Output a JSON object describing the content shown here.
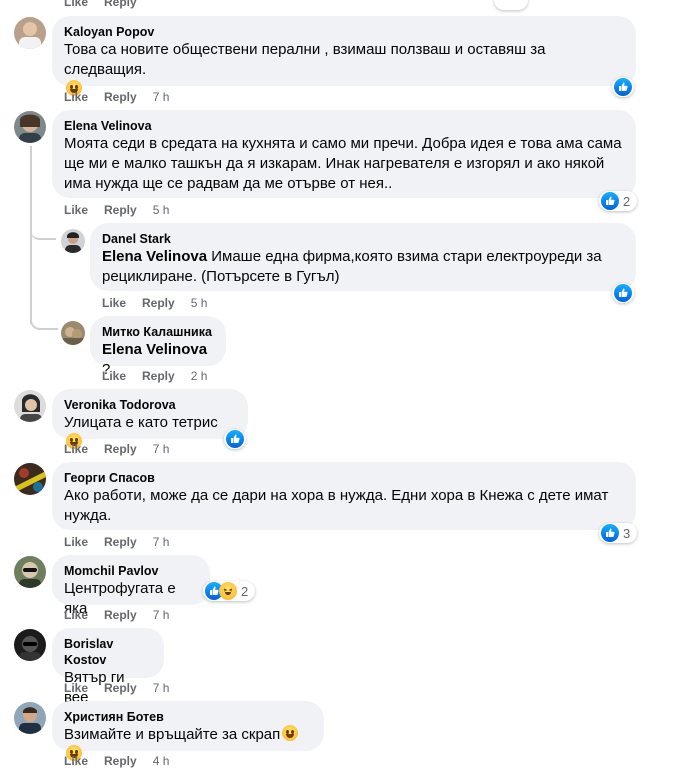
{
  "top_actions": {
    "like": "Like",
    "reply": "Reply"
  },
  "colors": {
    "like_blue": "#1877f2",
    "bubble_bg": "#f0f2f5",
    "meta_gray": "#65676b"
  },
  "comments": [
    {
      "name": "Kaloyan Popov",
      "text": "Това са новите обществени перални , взимаш ползваш и оставяш за следващия.",
      "emoji": "smile",
      "like": "Like",
      "reply": "Reply",
      "time": "7 h",
      "reactions": {
        "icons": [
          "like"
        ],
        "count": ""
      }
    },
    {
      "name": "Elena Velinova",
      "text": "Моята седи в средата на кухнята и само ми пречи. Добра идея е това ама сама ще ми е малко ташкън да я изкарам. Инак нагревателя е изгорял и ако някой има нужда ще се радвам да ме отърве от нея..",
      "like": "Like",
      "reply": "Reply",
      "time": "5 h",
      "reactions": {
        "icons": [
          "like"
        ],
        "count": "2"
      }
    },
    {
      "name": "Danel Stark",
      "mention": "Elena Velinova",
      "text": " Имаше една фирма,която взима стари електроуреди за рециклиране. (Потърсете в Гугъл)",
      "like": "Like",
      "reply": "Reply",
      "time": "5 h",
      "reactions": {
        "icons": [
          "like"
        ],
        "count": ""
      }
    },
    {
      "name": "Митко Калашника",
      "mention": "Elena Velinova",
      "text": " ?",
      "like": "Like",
      "reply": "Reply",
      "time": "2 h"
    },
    {
      "name": "Veronika Todorova",
      "text": "Улицата е като тетрис",
      "emoji": "grin",
      "like": "Like",
      "reply": "Reply",
      "time": "7 h",
      "reactions": {
        "icons": [
          "like"
        ],
        "count": ""
      }
    },
    {
      "name": "Георги Спасов",
      "text": "Ако работи, може да се дари на хора в нужда. Едни хора в Кнежа с дете имат нужда.",
      "like": "Like",
      "reply": "Reply",
      "time": "7 h",
      "reactions": {
        "icons": [
          "like"
        ],
        "count": "3"
      }
    },
    {
      "name": "Momchil Pavlov",
      "text": "Центрофугата е яка",
      "like": "Like",
      "reply": "Reply",
      "time": "7 h",
      "reactions": {
        "icons": [
          "like",
          "haha"
        ],
        "count": "2"
      }
    },
    {
      "name": "Borislav Kostov",
      "text": "Вятър ги вее",
      "like": "Like",
      "reply": "Reply",
      "time": "7 h"
    },
    {
      "name": "Християн Ботев",
      "text": "Взимайте и връщайте за скрап",
      "emoji": "laugh-tears",
      "like": "Like",
      "reply": "Reply",
      "time": "4 h"
    }
  ]
}
